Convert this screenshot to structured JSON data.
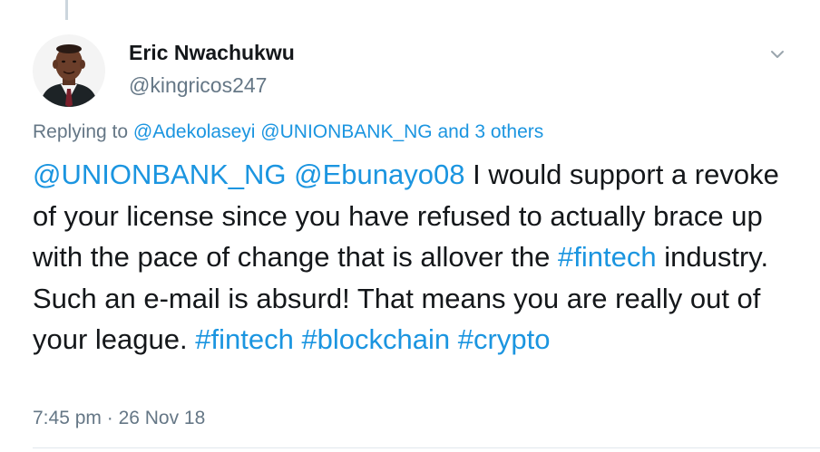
{
  "tweet": {
    "author": {
      "name": "Eric Nwachukwu",
      "handle": "@kingricos247"
    },
    "reply_context": {
      "prefix": "Replying to",
      "mentions": "@Adekolaseyi @UNIONBANK_NG",
      "and_word": "and",
      "others": "3 others"
    },
    "text": {
      "mention_1": "@UNIONBANK_NG",
      "mention_2": "@Ebunayo08",
      "part_1": " I would support a revoke of your license since you have refused to actually brace up with the pace of change that is allover the ",
      "hashtag_inline": "#fintech",
      "part_2": " industry. Such an e-mail is absurd! That means you are really out of your league. ",
      "hashtag_1": "#fintech",
      "hashtag_2": "#blockchain",
      "hashtag_3": "#crypto"
    },
    "timestamp": {
      "time": "7:45 pm",
      "separator": " · ",
      "date": "26 Nov 18"
    }
  },
  "icons": {
    "menu": "chevron-down-icon",
    "avatar": "profile-photo"
  },
  "colors": {
    "link": "#1b95e0",
    "secondary_text": "#657786",
    "primary_text": "#14171a",
    "thread_line": "#ccd6dd"
  }
}
